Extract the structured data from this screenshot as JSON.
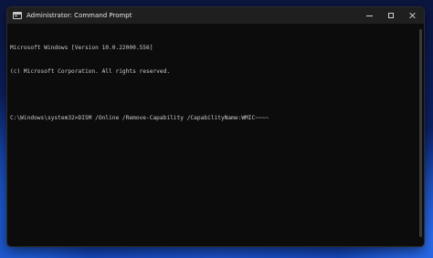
{
  "window": {
    "title": "Administrator: Command Prompt",
    "icon": "cmd-icon"
  },
  "controls": {
    "minimize": "minimize-icon",
    "maximize": "maximize-icon",
    "close": "close-icon"
  },
  "console": {
    "lines": [
      "Microsoft Windows [Version 10.0.22000.556]",
      "(c) Microsoft Corporation. All rights reserved.",
      "",
      "C:\\Windows\\system32>DISM /Online /Remove-Capability /CapabilityName:WMIC~~~~"
    ]
  }
}
